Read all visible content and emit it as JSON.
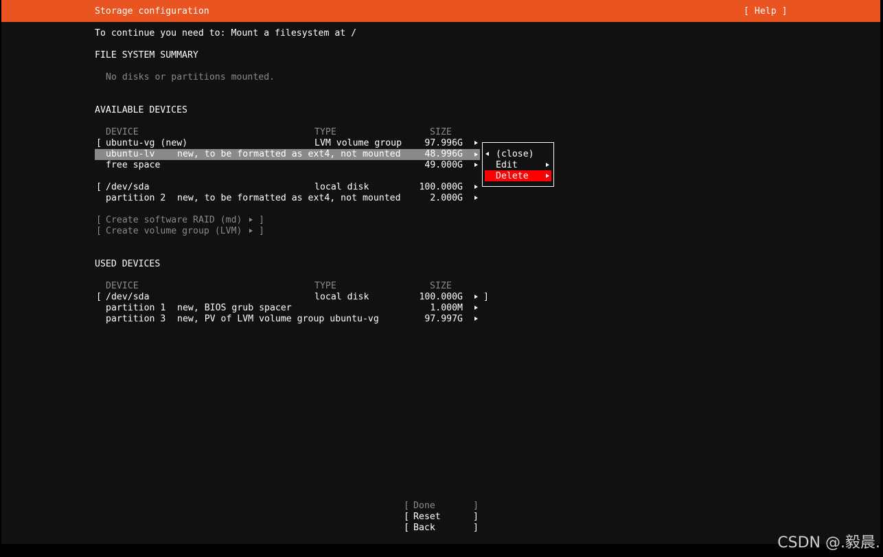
{
  "header": {
    "title": "Storage configuration",
    "help": "[ Help ]"
  },
  "message": "To continue you need to: Mount a filesystem at /",
  "fs_summary": {
    "heading": "FILE SYSTEM SUMMARY",
    "empty_text": "No disks or partitions mounted."
  },
  "available": {
    "heading": "AVAILABLE DEVICES",
    "columns": {
      "device": "DEVICE",
      "type": "TYPE",
      "size": "SIZE"
    },
    "rows": [
      {
        "bracket": "[",
        "device": "ubuntu-vg (new)",
        "type": "LVM volume group",
        "size": "97.996G"
      },
      {
        "device": "ubuntu-lv",
        "type": "new, to be formatted as ext4, not mounted",
        "size": "48.996G"
      },
      {
        "device": "free space",
        "size": "49.000G"
      },
      {
        "bracket": "[",
        "device": "/dev/sda",
        "type": "local disk",
        "size": "100.000G"
      },
      {
        "device": "partition 2",
        "type": "new, to be formatted as ext4, not mounted",
        "size": "2.000G"
      }
    ],
    "actions": [
      {
        "open": "[",
        "label": "Create software RAID (md)",
        "close": "]"
      },
      {
        "open": "[",
        "label": "Create volume group (LVM)",
        "close": "]"
      }
    ]
  },
  "context_menu": {
    "items": [
      "(close)",
      "Edit",
      "Delete"
    ]
  },
  "used": {
    "heading": "USED DEVICES",
    "columns": {
      "device": "DEVICE",
      "type": "TYPE",
      "size": "SIZE"
    },
    "rows": [
      {
        "bracket": "[",
        "device": "/dev/sda",
        "type": "local disk",
        "size": "100.000G",
        "close": "]"
      },
      {
        "device": "partition 1",
        "type": "new, BIOS grub spacer",
        "size": "1.000M"
      },
      {
        "device": "partition 3",
        "type": "new, PV of LVM volume group ubuntu-vg",
        "size": "97.997G"
      }
    ]
  },
  "footer": {
    "buttons": [
      {
        "open": "[",
        "label": "Done",
        "close": "]"
      },
      {
        "open": "[",
        "label": "Reset",
        "close": "]"
      },
      {
        "open": "[",
        "label": "Back",
        "close": "]"
      }
    ]
  },
  "watermark": "CSDN @.毅晨.",
  "colors": {
    "accent": "#e95420",
    "background": "#111111",
    "selection": "#8a8a8a",
    "danger": "#ff0000",
    "disabled": "#8a8a8a"
  },
  "icons": {
    "row_action": "right-triangle-icon",
    "menu_back": "left-triangle-icon"
  }
}
